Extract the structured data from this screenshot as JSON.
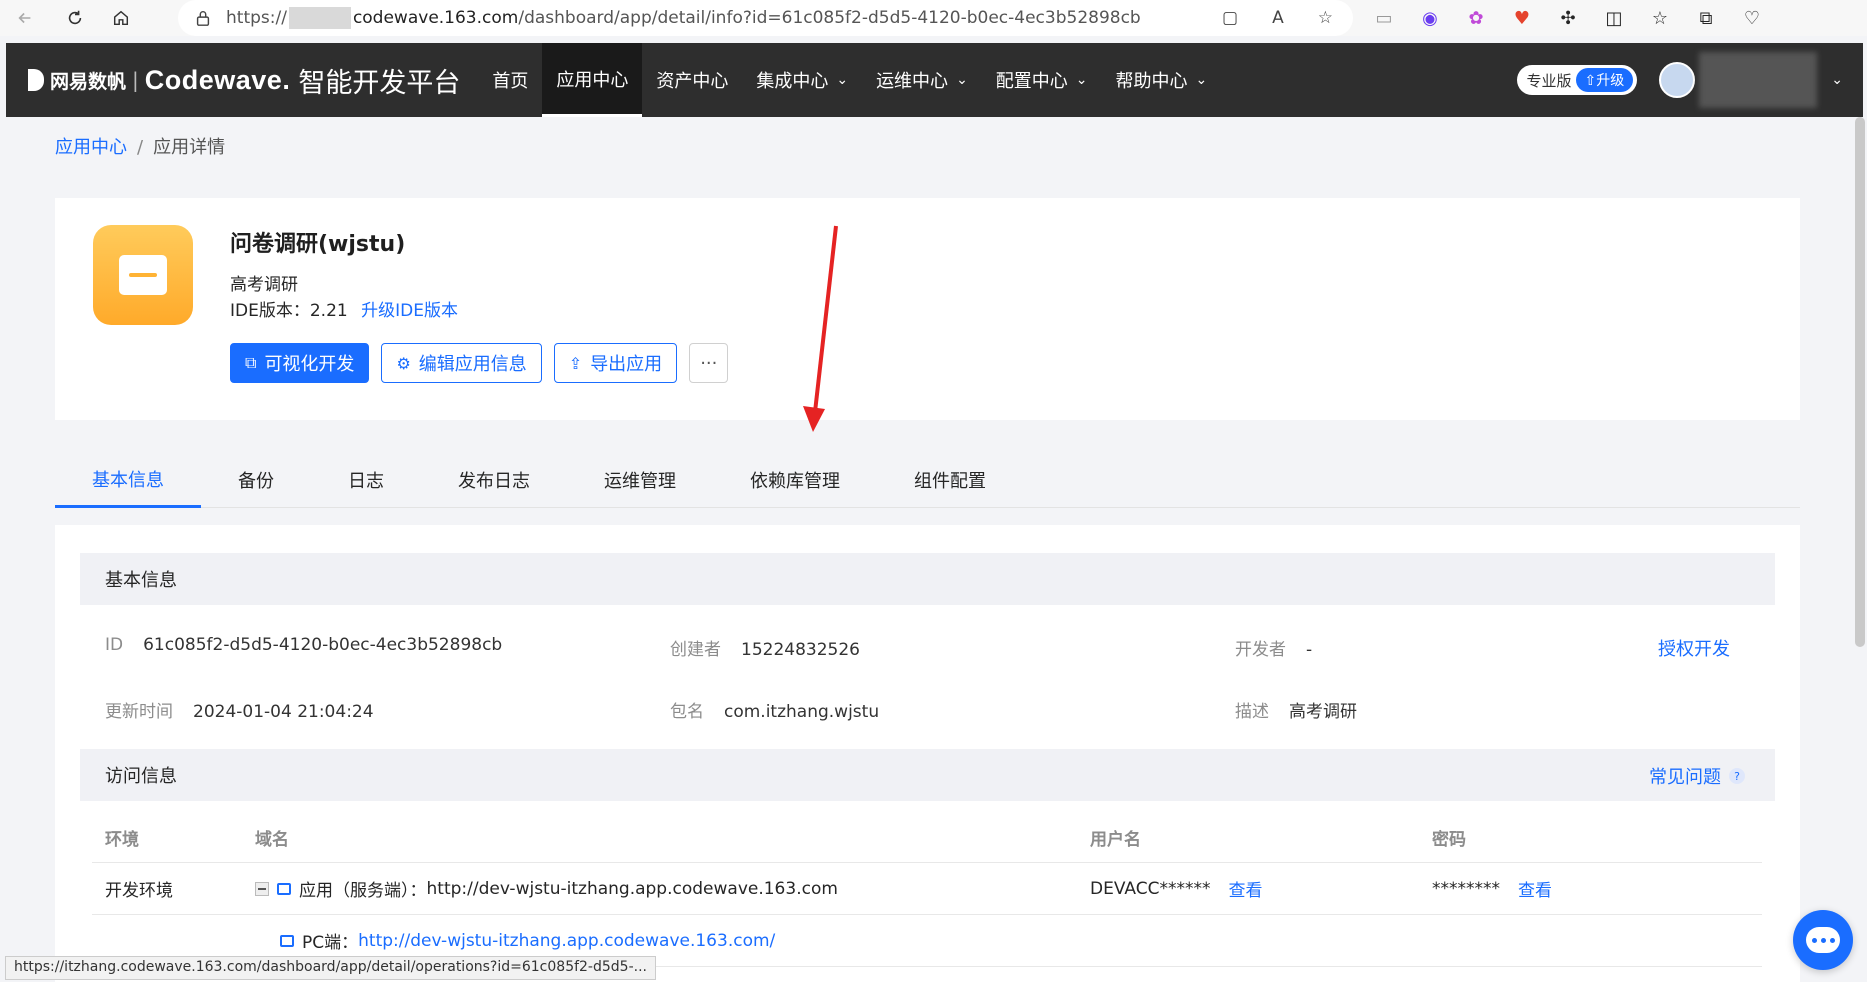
{
  "browser": {
    "url_prefix": "https://",
    "url_host": "codewave.163.com",
    "url_path": "/dashboard/app/detail/info?id=61c085f2-d5d5-4120-b0ec-4ec3b52898cb",
    "status_url": "https://itzhang.codewave.163.com/dashboard/app/detail/operations?id=61c085f2-d5d5-..."
  },
  "header": {
    "brand_cn": "网易数帆",
    "brand_en": "Codewave.",
    "brand_sub": "智能开发平台",
    "nav": [
      {
        "label": "首页",
        "dropdown": false
      },
      {
        "label": "应用中心",
        "dropdown": false,
        "active": true
      },
      {
        "label": "资产中心",
        "dropdown": false
      },
      {
        "label": "集成中心",
        "dropdown": true
      },
      {
        "label": "运维中心",
        "dropdown": true
      },
      {
        "label": "配置中心",
        "dropdown": true
      },
      {
        "label": "帮助中心",
        "dropdown": true
      }
    ],
    "plan": "专业版",
    "upgrade": "升级"
  },
  "breadcrumb": {
    "root": "应用中心",
    "current": "应用详情"
  },
  "app": {
    "name": "问卷调研(wjstu)",
    "description": "高考调研",
    "ide_label": "IDE版本：2.21",
    "ide_upgrade": "升级IDE版本",
    "buttons": {
      "visual_dev": "可视化开发",
      "edit_info": "编辑应用信息",
      "export": "导出应用",
      "more": "···"
    }
  },
  "tabs": [
    "基本信息",
    "备份",
    "日志",
    "发布日志",
    "运维管理",
    "依赖库管理",
    "组件配置"
  ],
  "basic_info": {
    "title": "基本信息",
    "id_label": "ID",
    "id_value": "61c085f2-d5d5-4120-b0ec-4ec3b52898cb",
    "creator_label": "创建者",
    "creator_value": "15224832526",
    "developer_label": "开发者",
    "developer_value": "-",
    "auth_dev": "授权开发",
    "updated_label": "更新时间",
    "updated_value": "2024-01-04 21:04:24",
    "package_label": "包名",
    "package_value": "com.itzhang.wjstu",
    "desc_label": "描述",
    "desc_value": "高考调研"
  },
  "access_info": {
    "title": "访问信息",
    "faq": "常见问题",
    "columns": [
      "环境",
      "域名",
      "用户名",
      "密码"
    ],
    "env": "开发环境",
    "app_server_label": "应用（服务端）：",
    "app_server_url": "http://dev-wjstu-itzhang.app.codewave.163.com",
    "username": "DEVACC******",
    "password": "********",
    "view": "查看",
    "pc_label": "PC端：",
    "pc_url": "http://dev-wjstu-itzhang.app.codewave.163.com/"
  }
}
